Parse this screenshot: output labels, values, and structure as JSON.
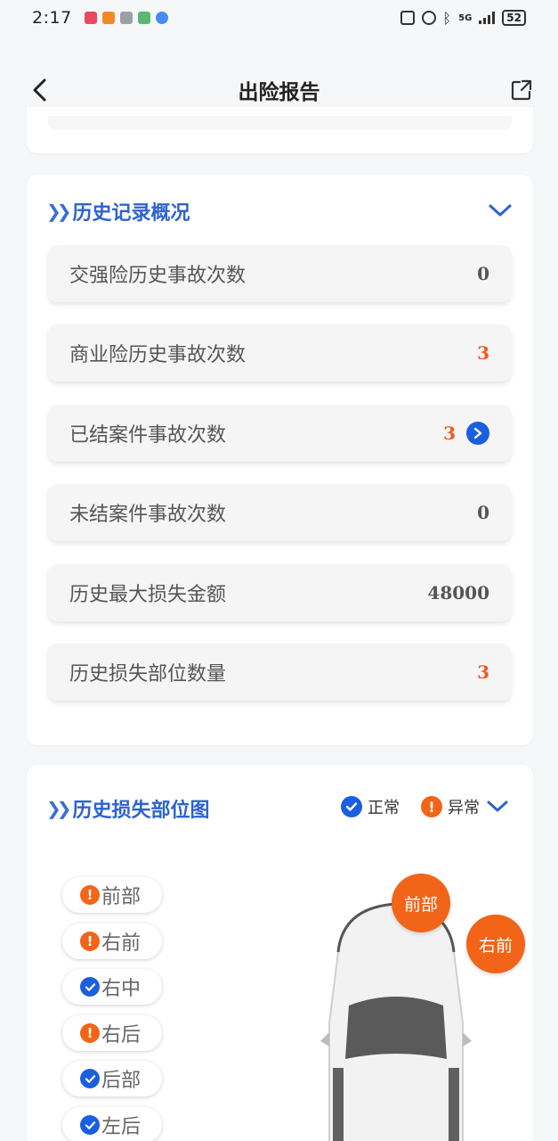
{
  "status_bar": {
    "time": "2:17",
    "network": "5G",
    "battery": "52"
  },
  "nav": {
    "title": "出险报告"
  },
  "history": {
    "title": "历史记录概况",
    "rows": [
      {
        "label": "交强险历史事故次数",
        "value": "0",
        "alert": false
      },
      {
        "label": "商业险历史事故次数",
        "value": "3",
        "alert": true
      },
      {
        "label": "已结案件事故次数",
        "value": "3",
        "alert": true,
        "has_link": true
      },
      {
        "label": "未结案件事故次数",
        "value": "0",
        "alert": false
      },
      {
        "label": "历史最大损失金额",
        "value": "48000",
        "alert": false
      },
      {
        "label": "历史损失部位数量",
        "value": "3",
        "alert": true
      }
    ]
  },
  "parts": {
    "title": "历史损失部位图",
    "legend_normal": "正常",
    "legend_abnormal": "异常",
    "items": [
      {
        "label": "前部",
        "status": "abnormal"
      },
      {
        "label": "右前",
        "status": "abnormal"
      },
      {
        "label": "右中",
        "status": "normal"
      },
      {
        "label": "右后",
        "status": "abnormal"
      },
      {
        "label": "后部",
        "status": "normal"
      },
      {
        "label": "左后",
        "status": "normal"
      }
    ],
    "damage_markers": [
      "前部",
      "右前"
    ]
  },
  "colors": {
    "accent": "#2e63cf",
    "alert": "#f05a1e",
    "normal": "#1a5fe0"
  }
}
